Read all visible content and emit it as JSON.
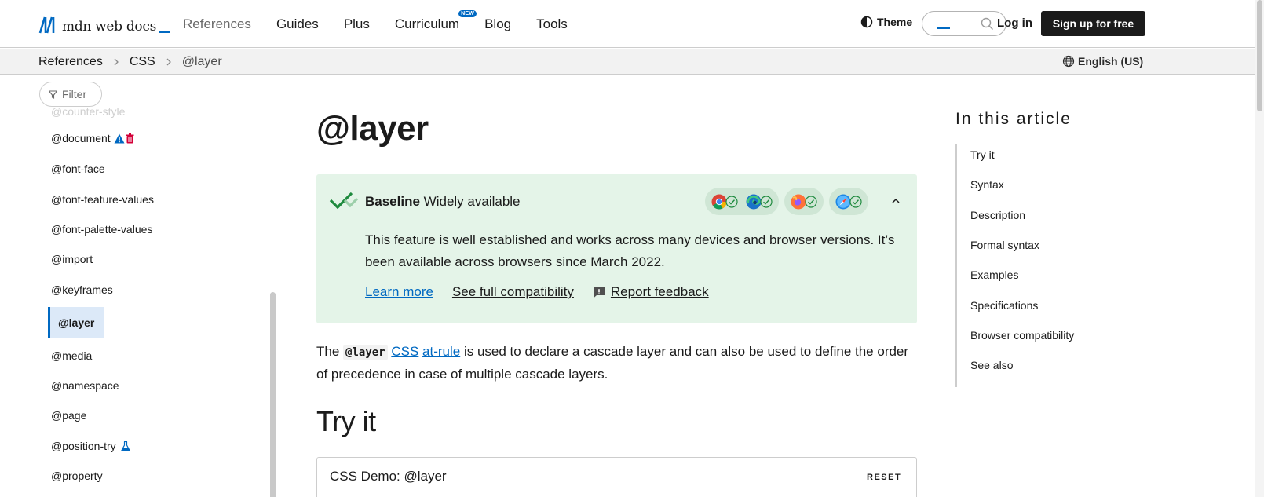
{
  "header": {
    "logo_text": "mdn web docs",
    "nav": [
      {
        "label": "References"
      },
      {
        "label": "Guides"
      },
      {
        "label": "Plus"
      },
      {
        "label": "Curriculum",
        "badge": "NEW"
      },
      {
        "label": "Blog"
      },
      {
        "label": "Tools"
      }
    ],
    "theme_label": "Theme",
    "login_label": "Log in",
    "signup_label": "Sign up for free"
  },
  "breadcrumb": {
    "items": [
      "References",
      "CSS",
      "@layer"
    ],
    "language": "English (US)"
  },
  "sidebar": {
    "filter_label": "Filter",
    "faded_item": "@counter-style",
    "items": [
      {
        "label": "@document"
      },
      {
        "label": "@font-face"
      },
      {
        "label": "@font-feature-values"
      },
      {
        "label": "@font-palette-values"
      },
      {
        "label": "@import"
      },
      {
        "label": "@keyframes"
      },
      {
        "label": "@layer"
      },
      {
        "label": "@media"
      },
      {
        "label": "@namespace"
      },
      {
        "label": "@page"
      },
      {
        "label": "@position-try"
      },
      {
        "label": "@property"
      }
    ]
  },
  "article": {
    "title": "@layer",
    "baseline": {
      "label": "Baseline",
      "status": "Widely available",
      "description": "This feature is well established and works across many devices and browser versions. It’s been available across browsers since March 2022.",
      "learn_more": "Learn more",
      "full_compat": "See full compatibility",
      "report": "Report feedback"
    },
    "intro": {
      "p1": "The ",
      "code": "@layer",
      "link_css": "CSS",
      "link_atrule": "at-rule",
      "p2": " is used to declare a cascade layer and can also be used to define the order of precedence in case of multiple cascade layers."
    },
    "try_it_heading": "Try it",
    "demo": {
      "title": "CSS Demo: @layer",
      "reset": "RESET"
    }
  },
  "toc": {
    "title": "In this article",
    "items": [
      "Try it",
      "Syntax",
      "Description",
      "Formal syntax",
      "Examples",
      "Specifications",
      "Browser compatibility",
      "See also"
    ]
  },
  "colors": {
    "link": "#0069c2",
    "baseline_bg": "#e4f4e8",
    "active_sidebar_bg": "#dce9f8",
    "dark_button": "#1b1b1b"
  }
}
